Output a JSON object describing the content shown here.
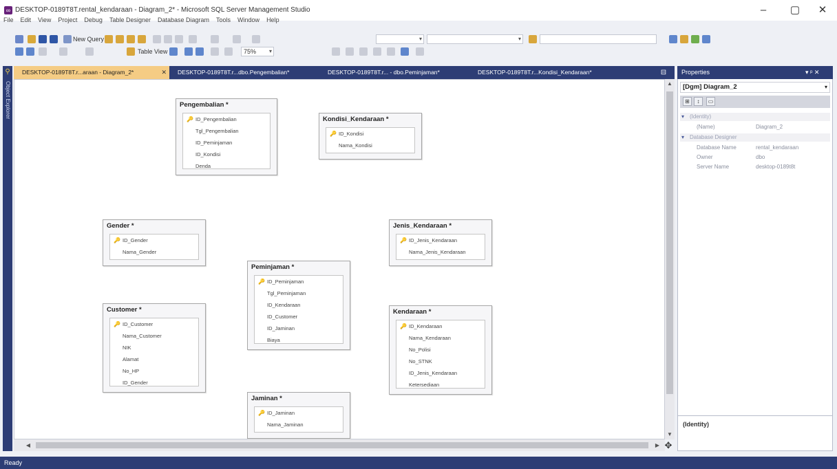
{
  "window": {
    "title": "DESKTOP-0189T8T.rental_kendaraan - Diagram_2* - Microsoft SQL Server Management Studio",
    "minimize": "–",
    "maximize": "▢",
    "close": "✕"
  },
  "menu": [
    "File",
    "Edit",
    "View",
    "Project",
    "Debug",
    "Table Designer",
    "Database Diagram",
    "Tools",
    "Window",
    "Help"
  ],
  "toolbar1": {
    "new_query": "New Query",
    "database_combo": ""
  },
  "toolbar2": {
    "table_view": "Table View",
    "zoom": "75%"
  },
  "tabs": [
    {
      "label": "DESKTOP-0189T8T.r...araan - Diagram_2*",
      "close": "✕"
    },
    {
      "label": "DESKTOP-0189T8T.r...dbo.Pengembalian*"
    },
    {
      "label": "DESKTOP-0189T8T.r... - dbo.Peminjaman*"
    },
    {
      "label": "DESKTOP-0189T8T.r...Kondisi_Kendaraan*"
    }
  ],
  "left_strip": {
    "label": "Object Explorer"
  },
  "diagram": {
    "tables": [
      {
        "name": "Pengembalian *",
        "columns": [
          {
            "name": "ID_Pengembalian",
            "pk": true
          },
          {
            "name": "Tgl_Pengembalian"
          },
          {
            "name": "ID_Peminjaman"
          },
          {
            "name": "ID_Kondisi"
          },
          {
            "name": "Denda"
          }
        ]
      },
      {
        "name": "Kondisi_Kendaraan *",
        "columns": [
          {
            "name": "ID_Kondisi",
            "pk": true
          },
          {
            "name": "Nama_Kondisi"
          }
        ]
      },
      {
        "name": "Gender *",
        "columns": [
          {
            "name": "ID_Gender",
            "pk": true
          },
          {
            "name": "Nama_Gender"
          }
        ]
      },
      {
        "name": "Jenis_Kendaraan *",
        "columns": [
          {
            "name": "ID_Jenis_Kendaraan",
            "pk": true
          },
          {
            "name": "Nama_Jenis_Kendaraan"
          }
        ]
      },
      {
        "name": "Peminjaman *",
        "columns": [
          {
            "name": "ID_Peminjaman",
            "pk": true
          },
          {
            "name": "Tgl_Peminjaman"
          },
          {
            "name": "ID_Kendaraan"
          },
          {
            "name": "ID_Customer"
          },
          {
            "name": "ID_Jaminan"
          },
          {
            "name": "Biaya"
          }
        ]
      },
      {
        "name": "Customer *",
        "columns": [
          {
            "name": "ID_Customer",
            "pk": true
          },
          {
            "name": "Nama_Customer"
          },
          {
            "name": "NIK"
          },
          {
            "name": "Alamat"
          },
          {
            "name": "No_HP"
          },
          {
            "name": "ID_Gender"
          }
        ]
      },
      {
        "name": "Kendaraan *",
        "columns": [
          {
            "name": "ID_Kendaraan",
            "pk": true
          },
          {
            "name": "Nama_Kendaraan"
          },
          {
            "name": "No_Polisi"
          },
          {
            "name": "No_STNK"
          },
          {
            "name": "ID_Jenis_Kendaraan"
          },
          {
            "name": "Ketersediaan"
          }
        ]
      },
      {
        "name": "Jaminan *",
        "columns": [
          {
            "name": "ID_Jaminan",
            "pk": true
          },
          {
            "name": "Nama_Jaminan"
          }
        ]
      }
    ]
  },
  "properties": {
    "title": "Properties",
    "controls": "▾ ᵖ ✕",
    "object": "[Dgm] Diagram_2",
    "categories": [
      {
        "name": "(Identity)",
        "rows": [
          {
            "key": "(Name)",
            "value": "Diagram_2"
          }
        ]
      },
      {
        "name": "Database Designer",
        "rows": [
          {
            "key": "Database Name",
            "value": "rental_kendaraan"
          },
          {
            "key": "Owner",
            "value": "dbo"
          },
          {
            "key": "Server Name",
            "value": "desktop-0189t8t"
          }
        ]
      }
    ],
    "description_title": "(Identity)"
  },
  "status": {
    "text": "Ready"
  },
  "colors": {
    "chrome": "#2d3d75",
    "active_tab": "#f5cc84",
    "key_icon": "#c8a21a"
  }
}
